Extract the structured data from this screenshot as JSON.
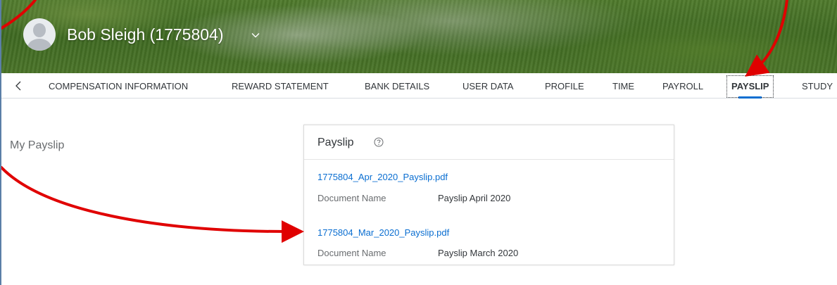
{
  "header": {
    "user_name": "Bob Sleigh (1775804)",
    "avatar_icon": "user-avatar-icon",
    "dropdown_icon": "chevron-down-icon"
  },
  "tabs": {
    "scroll_left_icon": "chevron-left-icon",
    "items": [
      {
        "label": "COMPENSATION INFORMATION",
        "selected": false
      },
      {
        "label": "REWARD STATEMENT",
        "selected": false
      },
      {
        "label": "BANK DETAILS",
        "selected": false
      },
      {
        "label": "USER DATA",
        "selected": false
      },
      {
        "label": "PROFILE",
        "selected": false
      },
      {
        "label": "TIME",
        "selected": false
      },
      {
        "label": "PAYROLL",
        "selected": false
      },
      {
        "label": "PAYSLIP",
        "selected": true
      },
      {
        "label": "STUDY",
        "selected": false
      }
    ],
    "accent_color": "#0a6ed1"
  },
  "main": {
    "section_title": "My Payslip",
    "card": {
      "title": "Payslip",
      "help_icon": "help-circle-icon",
      "documents": [
        {
          "file": "1775804_Apr_2020_Payslip.pdf",
          "label": "Document Name",
          "name": "Payslip April 2020"
        },
        {
          "file": "1775804_Mar_2020_Payslip.pdf",
          "label": "Document Name",
          "name": "Payslip March 2020"
        }
      ]
    }
  },
  "annotations": {
    "arrow_color": "#e00000"
  }
}
